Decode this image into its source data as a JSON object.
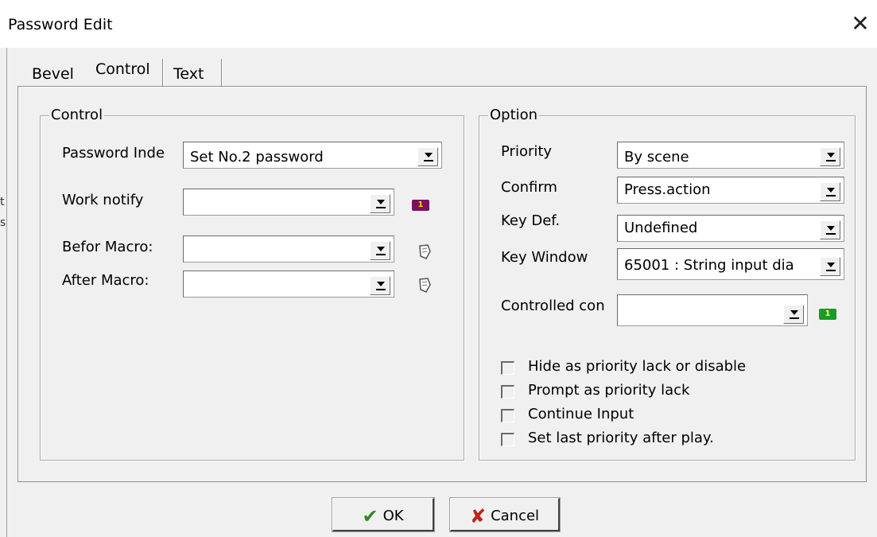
{
  "window": {
    "title": "Password Edit",
    "close_icon": "close-icon"
  },
  "stray": {
    "text1": "t",
    "text2": "s"
  },
  "tabs": [
    {
      "label": "Bevel"
    },
    {
      "label": "Control"
    },
    {
      "label": "Text"
    }
  ],
  "control_group": {
    "title": "Control",
    "password_index": {
      "label": "Password Inde",
      "value": "Set No.2 password"
    },
    "work_notify": {
      "label": "Work notify",
      "value": "",
      "badge": "1",
      "badge_color": "#7a1060"
    },
    "before_macro": {
      "label": "Befor Macro:",
      "value": "",
      "icon": "macro-icon"
    },
    "after_macro": {
      "label": "After Macro:",
      "value": "",
      "icon": "macro-icon"
    }
  },
  "option_group": {
    "title": "Option",
    "priority": {
      "label": "Priority",
      "value": "By scene"
    },
    "confirm": {
      "label": "Confirm",
      "value": "Press.action"
    },
    "key_def": {
      "label": "Key Def.",
      "value": "Undefined"
    },
    "key_window": {
      "label": "Key Window",
      "value": "65001 : String input dia"
    },
    "controlled_con": {
      "label": "Controlled con",
      "value": "",
      "badge": "1",
      "badge_color": "#1a9a2a"
    },
    "checkboxes": [
      {
        "label": "Hide as priority lack or disable",
        "checked": false
      },
      {
        "label": "Prompt as priority lack",
        "checked": false
      },
      {
        "label": "Continue Input",
        "checked": false
      },
      {
        "label": "Set last priority after play.",
        "checked": false
      }
    ]
  },
  "buttons": {
    "ok": {
      "label": "OK",
      "icon": "checkmark-icon",
      "icon_color": "#2e8b20"
    },
    "cancel": {
      "label": "Cancel",
      "icon": "x-icon",
      "icon_color": "#c0201a"
    }
  }
}
